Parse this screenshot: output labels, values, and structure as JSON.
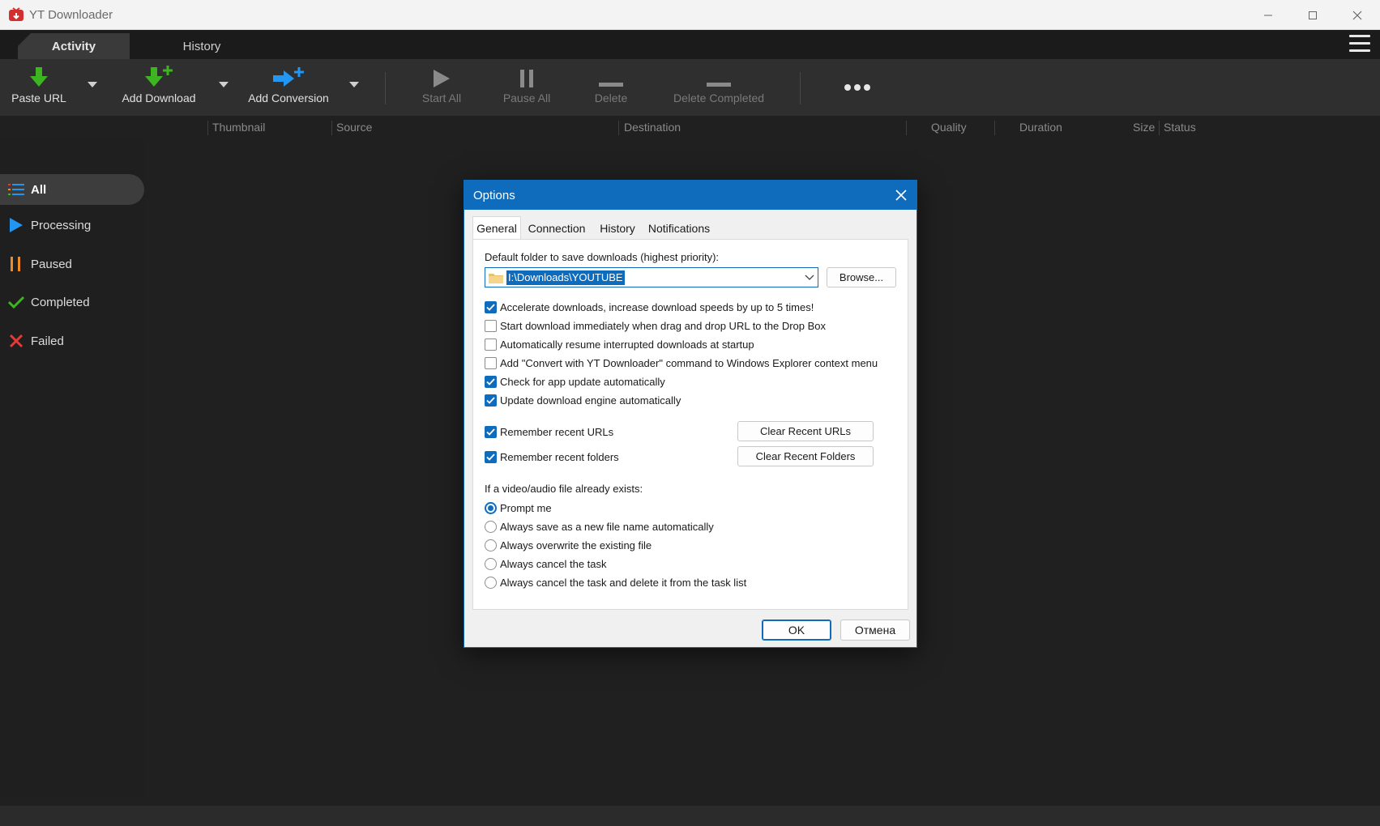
{
  "window": {
    "title": "YT Downloader",
    "controls": {
      "minimize": "minimize-icon",
      "maximize": "maximize-icon",
      "close": "close-icon"
    }
  },
  "main_tabs": [
    {
      "label": "Activity",
      "active": true
    },
    {
      "label": "History",
      "active": false
    }
  ],
  "toolbar": {
    "paste_url": "Paste URL",
    "add_download": "Add Download",
    "add_conversion": "Add Conversion",
    "start_all": "Start All",
    "pause_all": "Pause All",
    "delete": "Delete",
    "delete_completed": "Delete Completed"
  },
  "columns": {
    "thumbnail": "Thumbnail",
    "source": "Source",
    "destination": "Destination",
    "quality": "Quality",
    "duration": "Duration",
    "size": "Size",
    "status": "Status"
  },
  "sidebar": {
    "items": [
      {
        "label": "All",
        "icon": "list-icon",
        "active": true
      },
      {
        "label": "Processing",
        "icon": "play-icon",
        "active": false
      },
      {
        "label": "Paused",
        "icon": "pause-icon",
        "active": false
      },
      {
        "label": "Completed",
        "icon": "check-icon",
        "active": false
      },
      {
        "label": "Failed",
        "icon": "x-icon",
        "active": false
      }
    ]
  },
  "dialog": {
    "title": "Options",
    "tabs": [
      {
        "label": "General",
        "active": true
      },
      {
        "label": "Connection",
        "active": false
      },
      {
        "label": "History",
        "active": false
      },
      {
        "label": "Notifications",
        "active": false
      }
    ],
    "folder_label": "Default folder to save downloads (highest priority):",
    "folder_value": "I:\\Downloads\\YOUTUBE",
    "browse": "Browse...",
    "options": [
      {
        "label": "Accelerate downloads, increase download speeds by up to 5 times!",
        "checked": true
      },
      {
        "label": "Start download immediately when drag and drop URL to the Drop Box",
        "checked": false
      },
      {
        "label": "Automatically resume interrupted downloads at startup",
        "checked": false
      },
      {
        "label": "Add \"Convert with YT Downloader\" command to Windows Explorer context menu",
        "checked": false
      },
      {
        "label": "Check for app update automatically",
        "checked": true
      },
      {
        "label": "Update download engine automatically",
        "checked": true
      }
    ],
    "remember_urls": {
      "label": "Remember recent URLs",
      "checked": true
    },
    "remember_folders": {
      "label": "Remember recent folders",
      "checked": true
    },
    "clear_urls": "Clear Recent URLs",
    "clear_folders": "Clear Recent Folders",
    "exists_label": "If a video/audio file already exists:",
    "exists_options": [
      {
        "label": "Prompt me",
        "selected": true
      },
      {
        "label": "Always save as a new file name automatically",
        "selected": false
      },
      {
        "label": "Always overwrite the existing file",
        "selected": false
      },
      {
        "label": "Always cancel the task",
        "selected": false
      },
      {
        "label": "Always cancel the task and delete it from the task list",
        "selected": false
      }
    ],
    "ok": "OK",
    "cancel": "Отмена"
  },
  "colors": {
    "accent": "#0f6cbd",
    "green": "#3cb521",
    "blue": "#2196f3",
    "orange": "#f08a24",
    "red": "#e53935"
  }
}
